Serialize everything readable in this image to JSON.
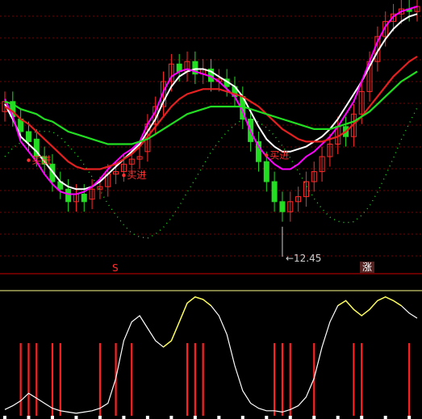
{
  "chart_data": [
    {
      "type": "candlestick",
      "panel": "price",
      "annotations": {
        "buy_label": "买进",
        "low_price_label": "12.45",
        "buy_points": [
          {
            "x": 3,
            "label": "买进"
          },
          {
            "x": 15,
            "label": "买进"
          },
          {
            "x": 33,
            "label": "买进"
          },
          {
            "x": 65,
            "label": "买进"
          },
          {
            "x": 74,
            "label": "买进"
          }
        ]
      },
      "series": [
        {
          "name": "",
          "color": "#ffffff",
          "values": [
            61,
            55,
            48,
            45,
            42,
            38,
            34,
            30,
            28,
            27,
            27,
            28,
            30,
            33,
            36,
            39,
            42,
            45,
            50,
            55,
            62,
            68,
            72,
            74,
            75,
            75,
            74,
            72,
            70,
            68,
            64,
            58,
            52,
            47,
            44,
            42,
            42,
            43,
            44,
            46,
            48,
            51,
            55,
            60,
            65,
            70,
            76,
            82,
            87,
            91,
            94,
            96,
            97
          ]
        },
        {
          "name": "",
          "color": "#ff00ff",
          "values": [
            63,
            56,
            46,
            42,
            38,
            33,
            29,
            26,
            25,
            25,
            26,
            28,
            31,
            35,
            38,
            41,
            43,
            46,
            53,
            58,
            66,
            72,
            74,
            75,
            74,
            73,
            72,
            70,
            67,
            64,
            58,
            50,
            44,
            40,
            37,
            35,
            35,
            37,
            40,
            42,
            45,
            48,
            52,
            57,
            62,
            70,
            78,
            86,
            92,
            96,
            98,
            99,
            100
          ]
        },
        {
          "name": "",
          "color": "#e52020",
          "values": [
            60,
            58,
            55,
            53,
            50,
            47,
            44,
            41,
            38,
            36,
            35,
            35,
            35,
            36,
            37,
            39,
            41,
            44,
            48,
            52,
            56,
            60,
            63,
            65,
            66,
            67,
            67,
            67,
            66,
            65,
            64,
            62,
            60,
            57,
            54,
            51,
            49,
            47,
            46,
            46,
            46,
            47,
            48,
            50,
            53,
            56,
            60,
            64,
            68,
            72,
            75,
            78,
            80
          ]
        },
        {
          "name": "",
          "color": "#22dd22",
          "values": [
            62,
            61,
            59,
            58,
            57,
            55,
            54,
            52,
            50,
            49,
            48,
            47,
            46,
            45,
            45,
            45,
            45,
            46,
            47,
            49,
            51,
            53,
            55,
            57,
            58,
            59,
            60,
            60,
            60,
            60,
            60,
            59,
            58,
            57,
            56,
            55,
            54,
            53,
            52,
            51,
            51,
            51,
            52,
            53,
            54,
            56,
            58,
            61,
            64,
            67,
            70,
            72,
            74
          ]
        }
      ],
      "candles": [
        {
          "o": 58,
          "c": 62
        },
        {
          "o": 62,
          "c": 56
        },
        {
          "o": 55,
          "c": 50
        },
        {
          "o": 50,
          "c": 46
        },
        {
          "o": 47,
          "c": 40
        },
        {
          "o": 40,
          "c": 37
        },
        {
          "o": 37,
          "c": 30
        },
        {
          "o": 30,
          "c": 27
        },
        {
          "o": 27,
          "c": 22
        },
        {
          "o": 22,
          "c": 25
        },
        {
          "o": 25,
          "c": 22
        },
        {
          "o": 23,
          "c": 27
        },
        {
          "o": 27,
          "c": 28
        },
        {
          "o": 28,
          "c": 33
        },
        {
          "o": 33,
          "c": 34
        },
        {
          "o": 34,
          "c": 37
        },
        {
          "o": 37,
          "c": 39
        },
        {
          "o": 39,
          "c": 40
        },
        {
          "o": 42,
          "c": 53
        },
        {
          "o": 53,
          "c": 60
        },
        {
          "o": 60,
          "c": 70
        },
        {
          "o": 70,
          "c": 77
        },
        {
          "o": 77,
          "c": 74
        },
        {
          "o": 74,
          "c": 78
        },
        {
          "o": 78,
          "c": 73
        },
        {
          "o": 73,
          "c": 75
        },
        {
          "o": 75,
          "c": 70
        },
        {
          "o": 70,
          "c": 71
        },
        {
          "o": 71,
          "c": 68
        },
        {
          "o": 68,
          "c": 64
        },
        {
          "o": 64,
          "c": 55
        },
        {
          "o": 55,
          "c": 46
        },
        {
          "o": 46,
          "c": 38
        },
        {
          "o": 38,
          "c": 30
        },
        {
          "o": 30,
          "c": 22
        },
        {
          "o": 22,
          "c": 18
        },
        {
          "o": 18,
          "c": 22
        },
        {
          "o": 22,
          "c": 24
        },
        {
          "o": 24,
          "c": 30
        },
        {
          "o": 30,
          "c": 34
        },
        {
          "o": 34,
          "c": 40
        },
        {
          "o": 40,
          "c": 45
        },
        {
          "o": 45,
          "c": 52
        },
        {
          "o": 52,
          "c": 48
        },
        {
          "o": 48,
          "c": 57
        },
        {
          "o": 57,
          "c": 66
        },
        {
          "o": 66,
          "c": 78
        },
        {
          "o": 78,
          "c": 88
        },
        {
          "o": 88,
          "c": 94
        },
        {
          "o": 94,
          "c": 97
        },
        {
          "o": 97,
          "c": 99
        },
        {
          "o": 99,
          "c": 98
        },
        {
          "o": 98,
          "c": 100
        }
      ],
      "ylim": [
        0,
        100
      ],
      "grid": "dotted-horizontal"
    },
    {
      "type": "line",
      "panel": "indicator",
      "markers": {
        "left_label": "S",
        "right_label": "涨"
      },
      "line": [
        5,
        8,
        12,
        18,
        14,
        10,
        6,
        4,
        3,
        2,
        3,
        4,
        6,
        10,
        30,
        60,
        75,
        80,
        70,
        60,
        55,
        60,
        75,
        90,
        95,
        93,
        88,
        80,
        65,
        40,
        20,
        10,
        6,
        4,
        4,
        3,
        5,
        8,
        15,
        30,
        55,
        75,
        88,
        92,
        85,
        80,
        85,
        92,
        95,
        92,
        88,
        82,
        78
      ],
      "yellow_segments": [
        [
          20,
          26
        ],
        [
          42,
          50
        ]
      ],
      "red_bars": [
        2,
        3,
        4,
        6,
        7,
        12,
        14,
        16,
        23,
        24,
        25,
        34,
        35,
        36,
        39,
        44,
        45,
        51
      ],
      "ylim": [
        0,
        100
      ]
    }
  ]
}
